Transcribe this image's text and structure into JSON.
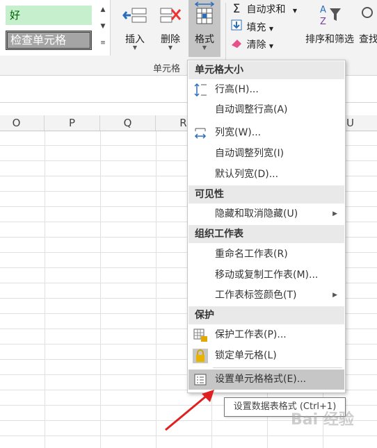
{
  "styles": {
    "good": "好",
    "check_cell": "检查单元格"
  },
  "ribbon": {
    "insert": "插入",
    "delete": "删除",
    "format": "格式",
    "autosum": "自动求和",
    "fill": "填充",
    "clear": "清除",
    "sort_filter": "排序和筛选",
    "find": "查找",
    "cells_group": "单元格"
  },
  "columns": [
    "O",
    "P",
    "Q",
    "R",
    "U"
  ],
  "menu": {
    "sections": {
      "cell_size": "单元格大小",
      "visibility": "可见性",
      "organize": "组织工作表",
      "protection": "保护"
    },
    "items": {
      "row_height": "行高(H)...",
      "autofit_row": "自动调整行高(A)",
      "col_width": "列宽(W)...",
      "autofit_col": "自动调整列宽(I)",
      "default_width": "默认列宽(D)...",
      "hide_unhide": "隐藏和取消隐藏(U)",
      "rename": "重命名工作表(R)",
      "move_copy": "移动或复制工作表(M)...",
      "tab_color": "工作表标签颜色(T)",
      "protect_sheet": "保护工作表(P)...",
      "lock_cell": "锁定单元格(L)",
      "format_cells": "设置单元格格式(E)..."
    }
  },
  "tooltip": "设置数据表格式 (Ctrl+1)",
  "watermark": "Bai 经验",
  "colors": {
    "highlight": "#c6c6c6",
    "arrow": "#e02020"
  }
}
